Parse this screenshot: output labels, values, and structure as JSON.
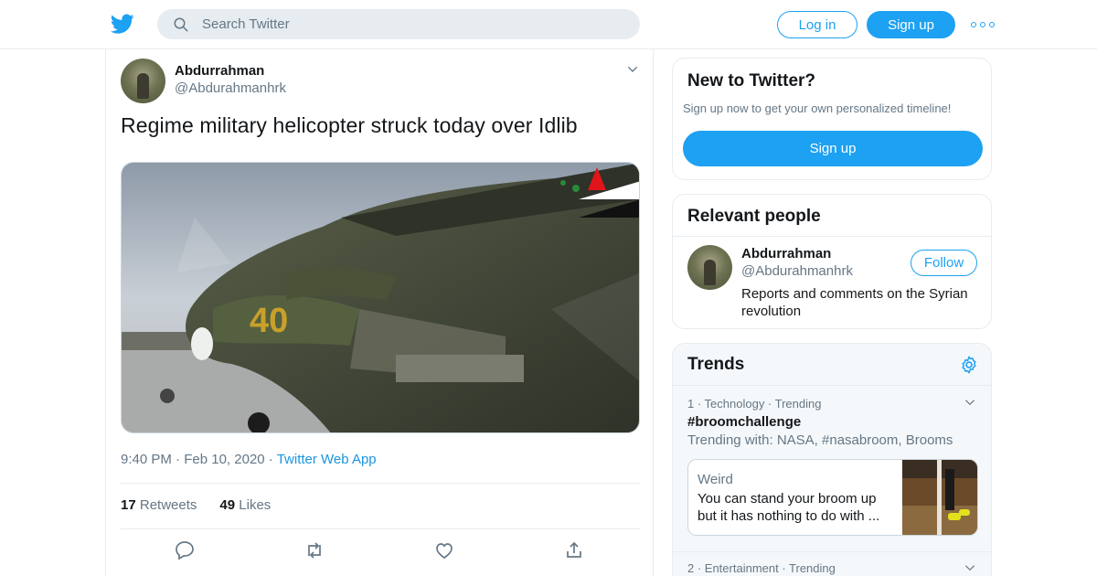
{
  "topbar": {
    "logo": "twitter-bird-icon",
    "search_placeholder": "Search Twitter",
    "login_label": "Log in",
    "signup_label": "Sign up",
    "more_icon": "more-dots-icon"
  },
  "tweet": {
    "author_name": "Abdurrahman",
    "author_handle": "@Abdurahmanhrk",
    "text": "Regime military helicopter struck today over Idlib",
    "time": "9:40 PM",
    "date": "Feb 10, 2020",
    "source": "Twitter Web App",
    "retweets_count": "17",
    "retweets_label": "Retweets",
    "likes_count": "49",
    "likes_label": "Likes",
    "media_overlay_text": "40"
  },
  "sidebar": {
    "new_to_twitter": {
      "title": "New to Twitter?",
      "subtitle": "Sign up now to get your own personalized timeline!",
      "button": "Sign up"
    },
    "relevant_people": {
      "title": "Relevant people",
      "name": "Abdurrahman",
      "handle": "@Abdurahmanhrk",
      "bio": "Reports and comments on the Syrian revolution",
      "follow_label": "Follow"
    },
    "trends": {
      "title": "Trends",
      "items": [
        {
          "meta": "1 · Technology · Trending",
          "name": "#broomchallenge",
          "with": "Trending with: NASA, #nasabroom, Brooms",
          "story_category": "Weird",
          "story_text": "You can stand your broom up but it has nothing to do with ..."
        },
        {
          "meta": "2 · Entertainment · Trending"
        }
      ]
    }
  },
  "colors": {
    "accent": "#1da1f2",
    "secondary_text": "#657786",
    "border": "#e6ecf0"
  }
}
